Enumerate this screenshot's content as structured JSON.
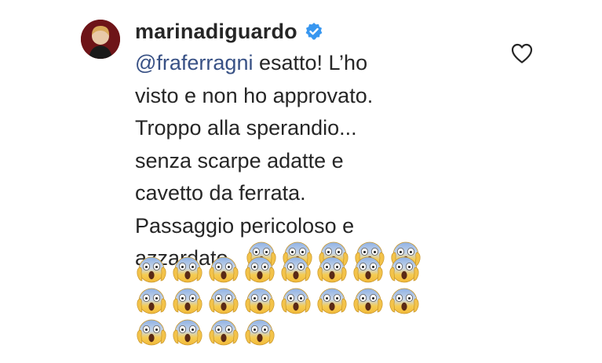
{
  "comment": {
    "username": "marinadiguardo",
    "verified": true,
    "mention": "@fraferragni",
    "lines": [
      " esatto! L’ho",
      "visto e non ho approvato.",
      "Troppo alla sperandio...",
      "senza scarpe adatte e",
      "cavetto da ferrata.",
      "Passaggio pericoloso e",
      "azzardato."
    ],
    "emoji_name": "face-screaming-in-fear",
    "emoji_rows": [
      5,
      8,
      8,
      4
    ]
  },
  "icons": {
    "like": "heart-outline-icon",
    "verified": "verified-badge-icon"
  },
  "colors": {
    "text": "#262626",
    "mention": "#385185",
    "verified": "#3897f0"
  }
}
